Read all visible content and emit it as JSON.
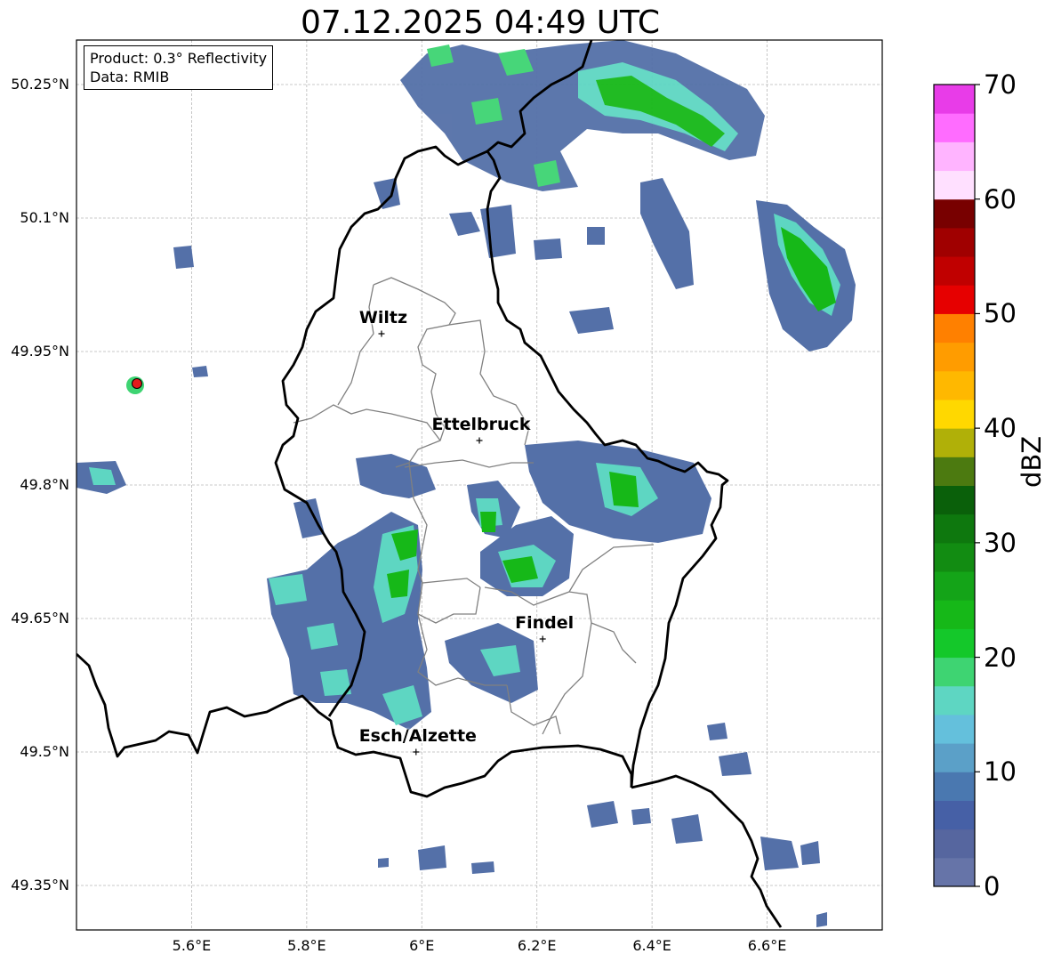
{
  "title": "07.12.2025 04:49 UTC",
  "info_box": {
    "product": "Product: 0.3° Reflectivity",
    "data": "Data: RMIB"
  },
  "axes": {
    "lon_range": [
      5.4,
      6.8
    ],
    "lat_range": [
      49.3,
      50.3
    ],
    "lat_ticks": [
      {
        "value": 50.25,
        "label": "50.25°N"
      },
      {
        "value": 50.1,
        "label": "50.1°N"
      },
      {
        "value": 49.95,
        "label": "49.95°N"
      },
      {
        "value": 49.8,
        "label": "49.8°N"
      },
      {
        "value": 49.65,
        "label": "49.65°N"
      },
      {
        "value": 49.5,
        "label": "49.5°N"
      },
      {
        "value": 49.35,
        "label": "49.35°N"
      }
    ],
    "lon_ticks": [
      {
        "value": 5.6,
        "label": "5.6°E"
      },
      {
        "value": 5.8,
        "label": "5.8°E"
      },
      {
        "value": 6.0,
        "label": "6°E"
      },
      {
        "value": 6.2,
        "label": "6.2°E"
      },
      {
        "value": 6.4,
        "label": "6.4°E"
      },
      {
        "value": 6.6,
        "label": "6.6°E"
      }
    ],
    "grid": true
  },
  "cities": [
    {
      "name": "Wiltz",
      "lon": 5.93,
      "lat": 49.97
    },
    {
      "name": "Ettelbruck",
      "lon": 6.1,
      "lat": 49.85
    },
    {
      "name": "Findel",
      "lon": 6.21,
      "lat": 49.627
    },
    {
      "name": "Esch/Alzette",
      "lon": 5.99,
      "lat": 49.5
    }
  ],
  "radar_site": {
    "lon": 5.505,
    "lat": 49.914,
    "color": "#e31a1c"
  },
  "colorbar": {
    "unit": "dBZ",
    "min": 0,
    "max": 70,
    "step": 2.5,
    "tick_labels": [
      "70",
      "60",
      "50",
      "40",
      "30",
      "20",
      "10",
      "0"
    ],
    "colors": [
      "#6674a8",
      "#56669f",
      "#4660a6",
      "#4a78b0",
      "#5ba0c8",
      "#64c0dc",
      "#5ed6c2",
      "#3ed472",
      "#14c82a",
      "#16b818",
      "#14a418",
      "#128c12",
      "#0e780e",
      "#0a600a",
      "#4c7a10",
      "#b0b008",
      "#ffd800",
      "#ffb800",
      "#ff9c00",
      "#ff8000",
      "#e60000",
      "#c00000",
      "#a00000",
      "#780000",
      "#ffe0ff",
      "#ffb4ff",
      "#ff6cff",
      "#e83ce8"
    ]
  }
}
